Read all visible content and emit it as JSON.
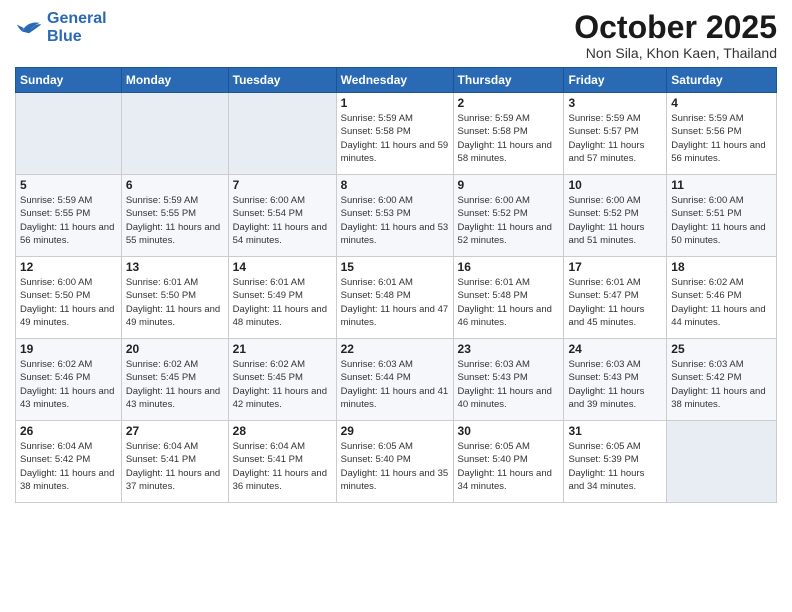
{
  "logo": {
    "line1": "General",
    "line2": "Blue"
  },
  "title": "October 2025",
  "subtitle": "Non Sila, Khon Kaen, Thailand",
  "weekdays": [
    "Sunday",
    "Monday",
    "Tuesday",
    "Wednesday",
    "Thursday",
    "Friday",
    "Saturday"
  ],
  "weeks": [
    [
      {
        "day": "",
        "sunrise": "",
        "sunset": "",
        "daylight": ""
      },
      {
        "day": "",
        "sunrise": "",
        "sunset": "",
        "daylight": ""
      },
      {
        "day": "",
        "sunrise": "",
        "sunset": "",
        "daylight": ""
      },
      {
        "day": "1",
        "sunrise": "Sunrise: 5:59 AM",
        "sunset": "Sunset: 5:58 PM",
        "daylight": "Daylight: 11 hours and 59 minutes."
      },
      {
        "day": "2",
        "sunrise": "Sunrise: 5:59 AM",
        "sunset": "Sunset: 5:58 PM",
        "daylight": "Daylight: 11 hours and 58 minutes."
      },
      {
        "day": "3",
        "sunrise": "Sunrise: 5:59 AM",
        "sunset": "Sunset: 5:57 PM",
        "daylight": "Daylight: 11 hours and 57 minutes."
      },
      {
        "day": "4",
        "sunrise": "Sunrise: 5:59 AM",
        "sunset": "Sunset: 5:56 PM",
        "daylight": "Daylight: 11 hours and 56 minutes."
      }
    ],
    [
      {
        "day": "5",
        "sunrise": "Sunrise: 5:59 AM",
        "sunset": "Sunset: 5:55 PM",
        "daylight": "Daylight: 11 hours and 56 minutes."
      },
      {
        "day": "6",
        "sunrise": "Sunrise: 5:59 AM",
        "sunset": "Sunset: 5:55 PM",
        "daylight": "Daylight: 11 hours and 55 minutes."
      },
      {
        "day": "7",
        "sunrise": "Sunrise: 6:00 AM",
        "sunset": "Sunset: 5:54 PM",
        "daylight": "Daylight: 11 hours and 54 minutes."
      },
      {
        "day": "8",
        "sunrise": "Sunrise: 6:00 AM",
        "sunset": "Sunset: 5:53 PM",
        "daylight": "Daylight: 11 hours and 53 minutes."
      },
      {
        "day": "9",
        "sunrise": "Sunrise: 6:00 AM",
        "sunset": "Sunset: 5:52 PM",
        "daylight": "Daylight: 11 hours and 52 minutes."
      },
      {
        "day": "10",
        "sunrise": "Sunrise: 6:00 AM",
        "sunset": "Sunset: 5:52 PM",
        "daylight": "Daylight: 11 hours and 51 minutes."
      },
      {
        "day": "11",
        "sunrise": "Sunrise: 6:00 AM",
        "sunset": "Sunset: 5:51 PM",
        "daylight": "Daylight: 11 hours and 50 minutes."
      }
    ],
    [
      {
        "day": "12",
        "sunrise": "Sunrise: 6:00 AM",
        "sunset": "Sunset: 5:50 PM",
        "daylight": "Daylight: 11 hours and 49 minutes."
      },
      {
        "day": "13",
        "sunrise": "Sunrise: 6:01 AM",
        "sunset": "Sunset: 5:50 PM",
        "daylight": "Daylight: 11 hours and 49 minutes."
      },
      {
        "day": "14",
        "sunrise": "Sunrise: 6:01 AM",
        "sunset": "Sunset: 5:49 PM",
        "daylight": "Daylight: 11 hours and 48 minutes."
      },
      {
        "day": "15",
        "sunrise": "Sunrise: 6:01 AM",
        "sunset": "Sunset: 5:48 PM",
        "daylight": "Daylight: 11 hours and 47 minutes."
      },
      {
        "day": "16",
        "sunrise": "Sunrise: 6:01 AM",
        "sunset": "Sunset: 5:48 PM",
        "daylight": "Daylight: 11 hours and 46 minutes."
      },
      {
        "day": "17",
        "sunrise": "Sunrise: 6:01 AM",
        "sunset": "Sunset: 5:47 PM",
        "daylight": "Daylight: 11 hours and 45 minutes."
      },
      {
        "day": "18",
        "sunrise": "Sunrise: 6:02 AM",
        "sunset": "Sunset: 5:46 PM",
        "daylight": "Daylight: 11 hours and 44 minutes."
      }
    ],
    [
      {
        "day": "19",
        "sunrise": "Sunrise: 6:02 AM",
        "sunset": "Sunset: 5:46 PM",
        "daylight": "Daylight: 11 hours and 43 minutes."
      },
      {
        "day": "20",
        "sunrise": "Sunrise: 6:02 AM",
        "sunset": "Sunset: 5:45 PM",
        "daylight": "Daylight: 11 hours and 43 minutes."
      },
      {
        "day": "21",
        "sunrise": "Sunrise: 6:02 AM",
        "sunset": "Sunset: 5:45 PM",
        "daylight": "Daylight: 11 hours and 42 minutes."
      },
      {
        "day": "22",
        "sunrise": "Sunrise: 6:03 AM",
        "sunset": "Sunset: 5:44 PM",
        "daylight": "Daylight: 11 hours and 41 minutes."
      },
      {
        "day": "23",
        "sunrise": "Sunrise: 6:03 AM",
        "sunset": "Sunset: 5:43 PM",
        "daylight": "Daylight: 11 hours and 40 minutes."
      },
      {
        "day": "24",
        "sunrise": "Sunrise: 6:03 AM",
        "sunset": "Sunset: 5:43 PM",
        "daylight": "Daylight: 11 hours and 39 minutes."
      },
      {
        "day": "25",
        "sunrise": "Sunrise: 6:03 AM",
        "sunset": "Sunset: 5:42 PM",
        "daylight": "Daylight: 11 hours and 38 minutes."
      }
    ],
    [
      {
        "day": "26",
        "sunrise": "Sunrise: 6:04 AM",
        "sunset": "Sunset: 5:42 PM",
        "daylight": "Daylight: 11 hours and 38 minutes."
      },
      {
        "day": "27",
        "sunrise": "Sunrise: 6:04 AM",
        "sunset": "Sunset: 5:41 PM",
        "daylight": "Daylight: 11 hours and 37 minutes."
      },
      {
        "day": "28",
        "sunrise": "Sunrise: 6:04 AM",
        "sunset": "Sunset: 5:41 PM",
        "daylight": "Daylight: 11 hours and 36 minutes."
      },
      {
        "day": "29",
        "sunrise": "Sunrise: 6:05 AM",
        "sunset": "Sunset: 5:40 PM",
        "daylight": "Daylight: 11 hours and 35 minutes."
      },
      {
        "day": "30",
        "sunrise": "Sunrise: 6:05 AM",
        "sunset": "Sunset: 5:40 PM",
        "daylight": "Daylight: 11 hours and 34 minutes."
      },
      {
        "day": "31",
        "sunrise": "Sunrise: 6:05 AM",
        "sunset": "Sunset: 5:39 PM",
        "daylight": "Daylight: 11 hours and 34 minutes."
      },
      {
        "day": "",
        "sunrise": "",
        "sunset": "",
        "daylight": ""
      }
    ]
  ]
}
